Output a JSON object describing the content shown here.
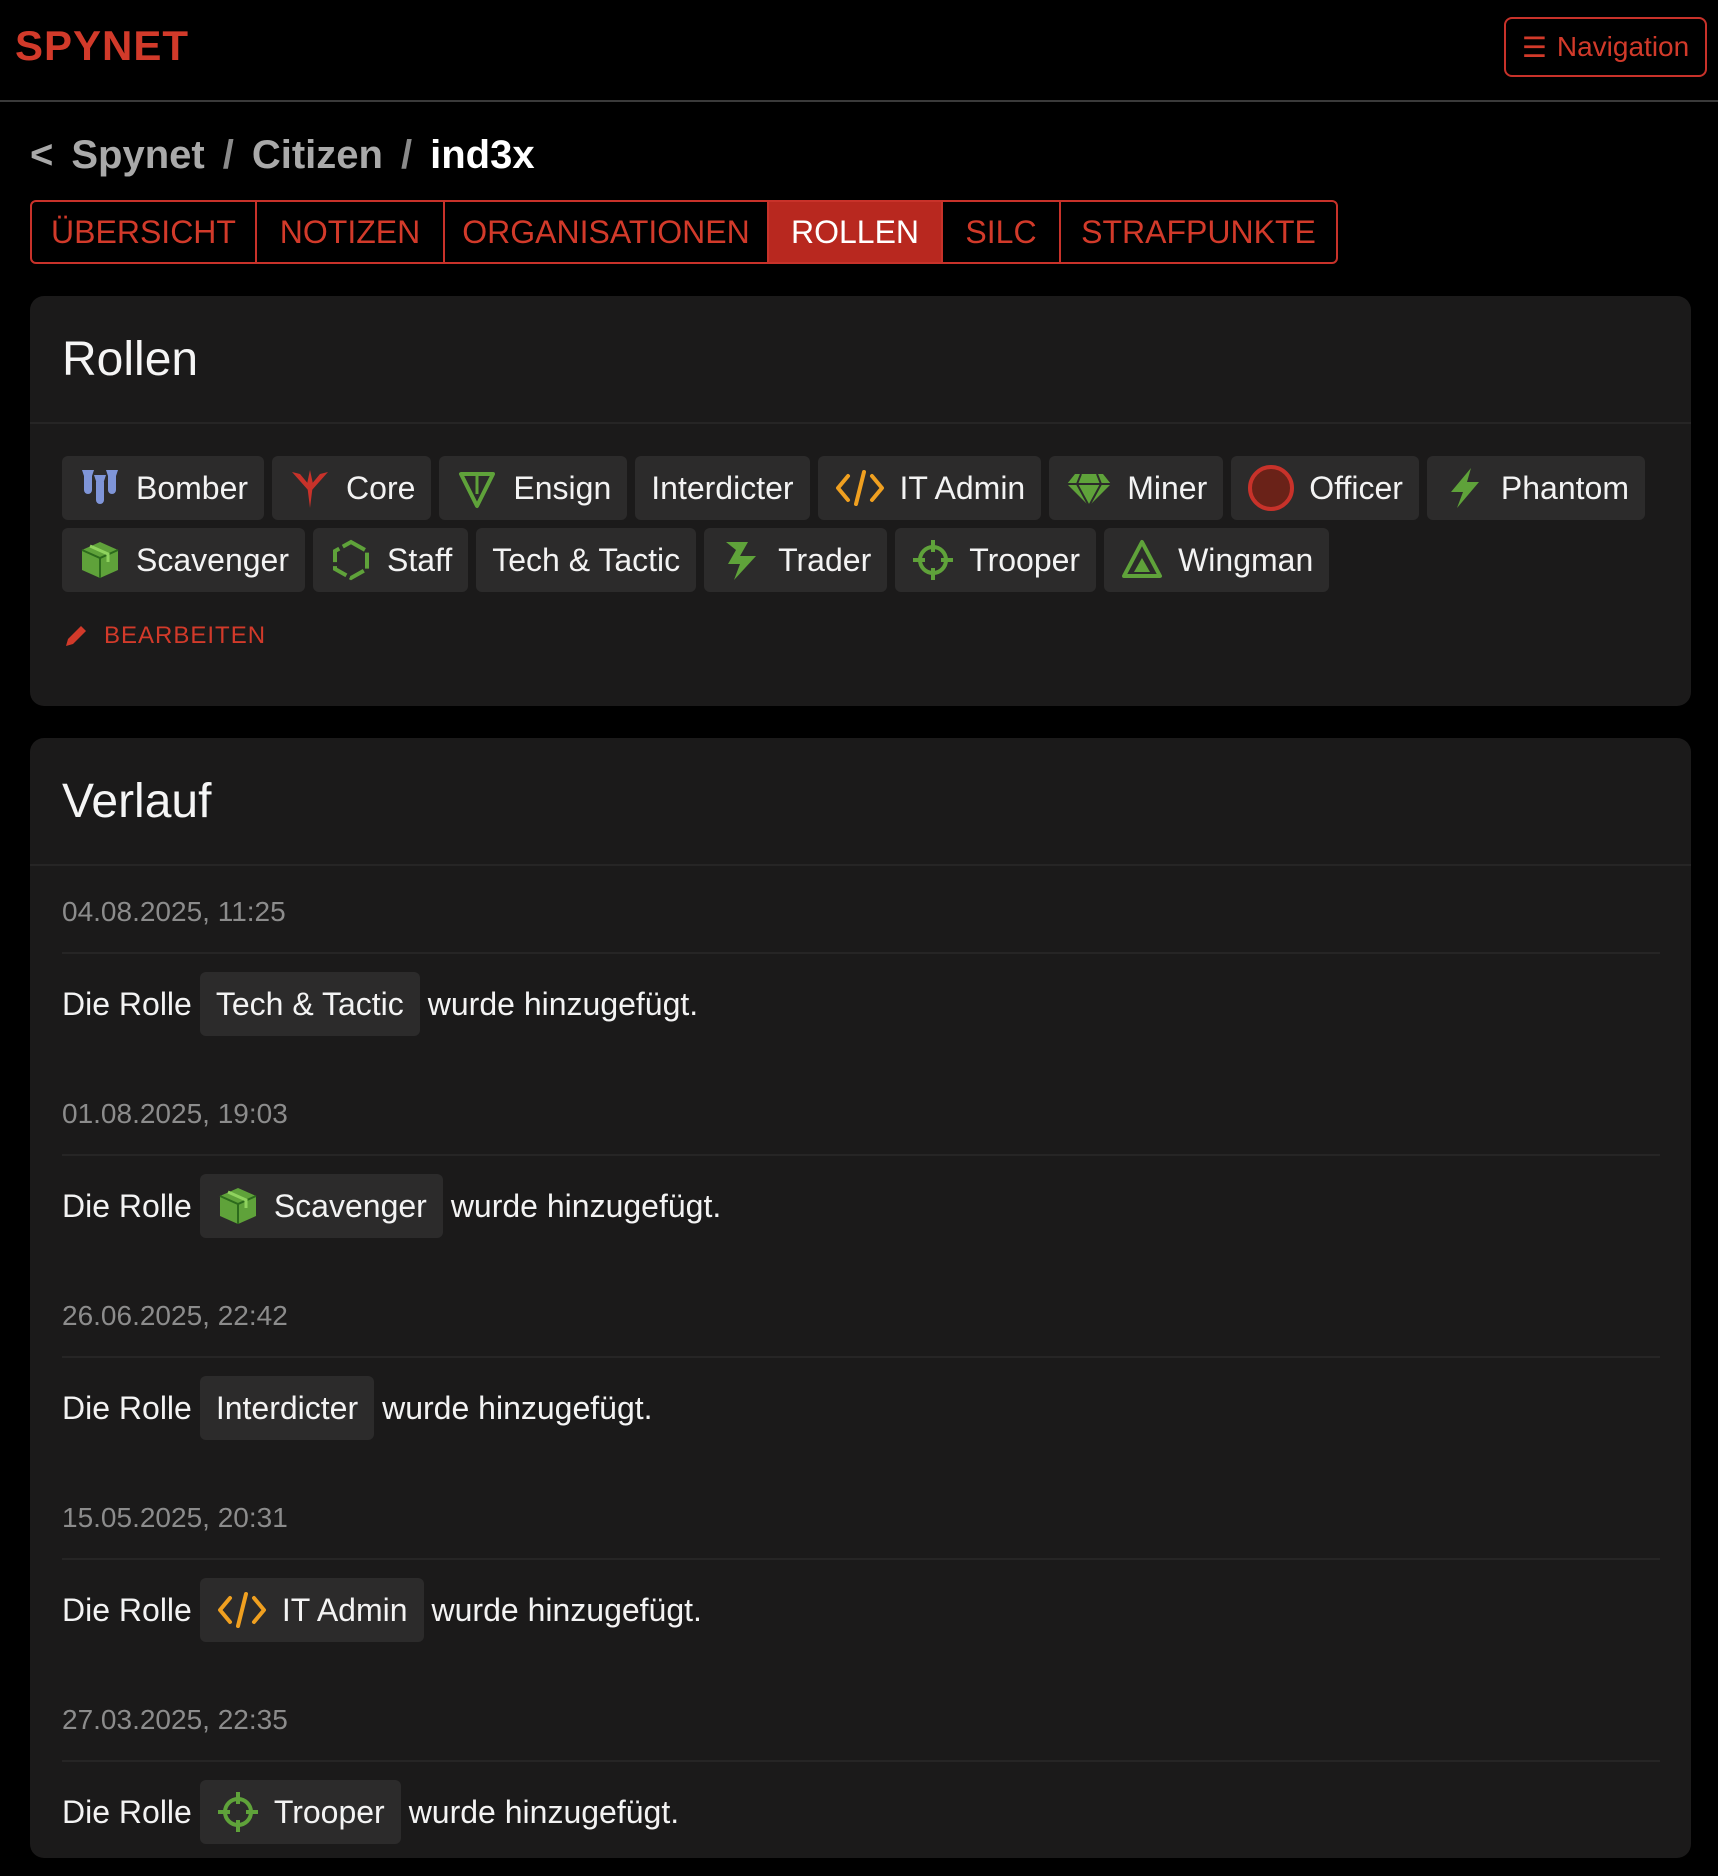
{
  "brand": "SPYNET",
  "nav_button": {
    "icon": "burger-menu-icon",
    "label": "Navigation"
  },
  "breadcrumb": {
    "back_symbol": "<",
    "items": [
      "Spynet",
      "Citizen",
      "ind3x"
    ],
    "separator": "/"
  },
  "tabs": [
    {
      "label": "ÜBERSICHT",
      "active": false
    },
    {
      "label": "NOTIZEN",
      "active": false
    },
    {
      "label": "ORGANISATIONEN",
      "active": false
    },
    {
      "label": "ROLLEN",
      "active": true
    },
    {
      "label": "SILC",
      "active": false
    },
    {
      "label": "STRAFPUNKTE",
      "active": false
    }
  ],
  "roles_card": {
    "title": "Rollen",
    "roles": [
      {
        "label": "Bomber",
        "icon": "bomb-cluster-icon"
      },
      {
        "label": "Core",
        "icon": "core-spike-icon"
      },
      {
        "label": "Ensign",
        "icon": "triangle-down-icon"
      },
      {
        "label": "Interdicter",
        "icon": ""
      },
      {
        "label": "IT Admin",
        "icon": "code-brackets-icon"
      },
      {
        "label": "Miner",
        "icon": "gem-icon"
      },
      {
        "label": "Officer",
        "icon": "red-circle-icon"
      },
      {
        "label": "Phantom",
        "icon": "lightning-icon"
      },
      {
        "label": "Scavenger",
        "icon": "crate-icon"
      },
      {
        "label": "Staff",
        "icon": "hexagon-icon"
      },
      {
        "label": "Tech & Tactic",
        "icon": ""
      },
      {
        "label": "Trader",
        "icon": "trader-bolt-icon"
      },
      {
        "label": "Trooper",
        "icon": "crosshair-icon"
      },
      {
        "label": "Wingman",
        "icon": "triangle-up-icon"
      }
    ],
    "edit_label": "BEARBEITEN"
  },
  "history_card": {
    "title": "Verlauf",
    "prefix": "Die Rolle",
    "suffix": "wurde hinzugefügt.",
    "entries": [
      {
        "date": "04.08.2025, 11:25",
        "role": "Tech & Tactic",
        "icon": ""
      },
      {
        "date": "01.08.2025, 19:03",
        "role": "Scavenger",
        "icon": "crate-icon"
      },
      {
        "date": "26.06.2025, 22:42",
        "role": "Interdicter",
        "icon": ""
      },
      {
        "date": "15.05.2025, 20:31",
        "role": "IT Admin",
        "icon": "code-brackets-icon"
      },
      {
        "date": "27.03.2025, 22:35",
        "role": "Trooper",
        "icon": "crosshair-icon"
      }
    ]
  },
  "colors": {
    "accent": "#d23a2a",
    "card": "#1b1a1a",
    "badge": "#2c2b2b",
    "green_icon": "#5fa23a",
    "orange_icon": "#f0a020",
    "blue_icon": "#7f95d8"
  }
}
